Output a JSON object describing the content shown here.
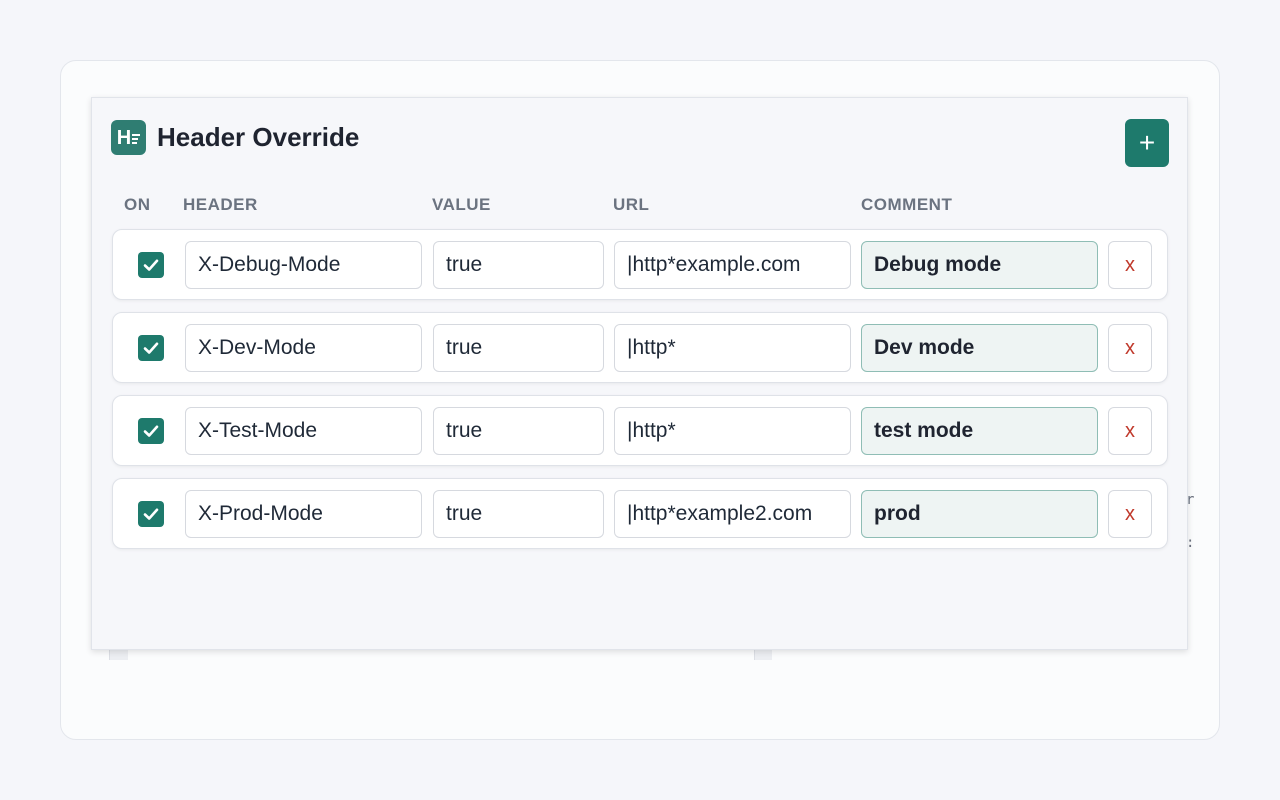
{
  "app": {
    "title": "Header Override",
    "logo_letter": "H",
    "add_label": "+",
    "accent_color": "#1e7a6c"
  },
  "columns": {
    "on": "ON",
    "header": "HEADER",
    "value": "VALUE",
    "url": "URL",
    "comment": "COMMENT"
  },
  "rows": [
    {
      "enabled": true,
      "header": "X-Debug-Mode",
      "value": "true",
      "url": "|http*example.com",
      "comment": "Debug mode",
      "delete_label": "x"
    },
    {
      "enabled": true,
      "header": "X-Dev-Mode",
      "value": "true",
      "url": "|http*",
      "comment": "Dev mode",
      "delete_label": "x"
    },
    {
      "enabled": true,
      "header": "X-Test-Mode",
      "value": "true",
      "url": "|http*",
      "comment": "test mode",
      "delete_label": "x"
    },
    {
      "enabled": true,
      "header": "X-Prod-Mode",
      "value": "true",
      "url": "|http*example2.com",
      "comment": "prod",
      "delete_label": "x"
    }
  ],
  "background_glyphs": [
    "r",
    ":"
  ]
}
